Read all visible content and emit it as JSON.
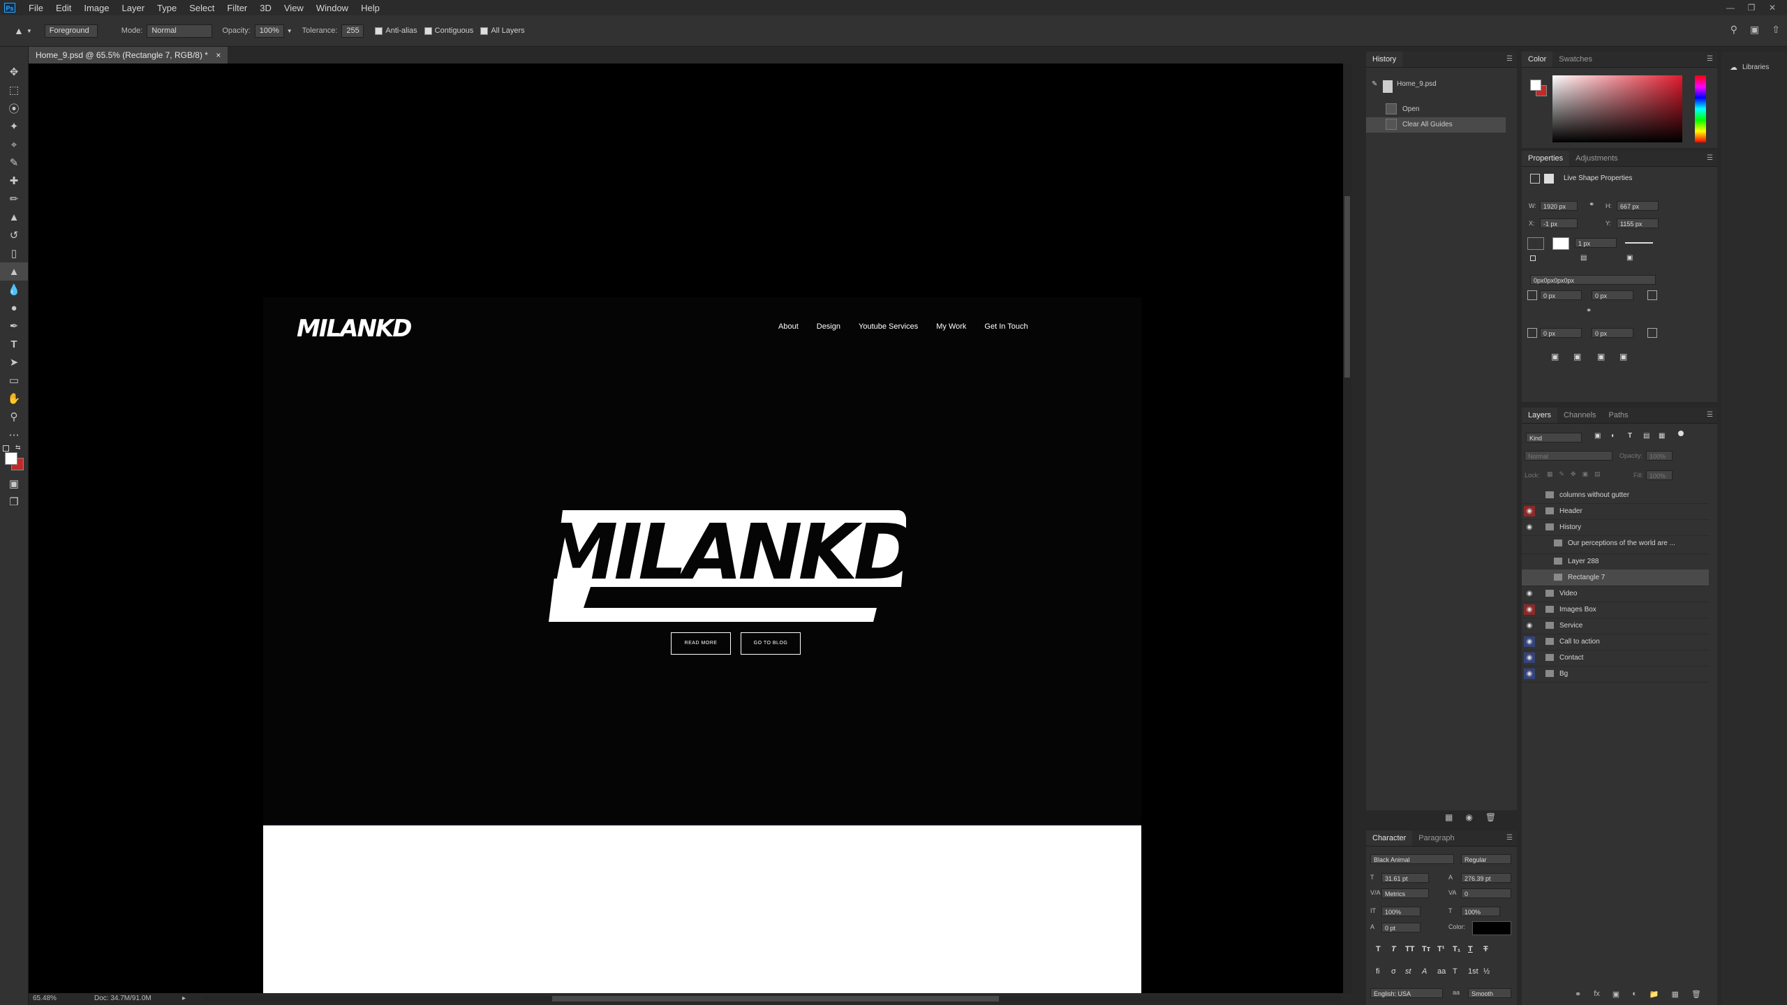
{
  "menu": {
    "items": [
      "File",
      "Edit",
      "Image",
      "Layer",
      "Type",
      "Select",
      "Filter",
      "3D",
      "View",
      "Window",
      "Help"
    ],
    "app_logo": "Ps"
  },
  "options": {
    "fill_source": "Foreground",
    "mode_label": "Mode:",
    "mode_value": "Normal",
    "opacity_label": "Opacity:",
    "opacity_value": "100%",
    "tolerance_label": "Tolerance:",
    "tolerance_value": "255",
    "anti_alias": "Anti-alias",
    "contiguous": "Contiguous",
    "all_layers": "All Layers"
  },
  "document": {
    "tab_title": "Home_9.psd @ 65.5% (Rectangle 7, RGB/8) *",
    "close": "×",
    "zoom": "65.48%",
    "doc_info": "Doc: 34.7M/91.0M"
  },
  "artboard": {
    "logo_small": "MILANKD",
    "nav": [
      "About",
      "Design",
      "Youtube Services",
      "My Work",
      "Get In Touch"
    ],
    "hero_logo": "MILANKD",
    "btn_read_more": "READ MORE",
    "btn_go_blog": "GO TO BLOG"
  },
  "history": {
    "tab": "History",
    "snapshot": "Home_9.psd",
    "steps": [
      "Open",
      "Clear All Guides"
    ]
  },
  "color_panel": {
    "tabs": [
      "Color",
      "Swatches"
    ]
  },
  "properties": {
    "tabs": [
      "Properties",
      "Adjustments"
    ],
    "heading": "Live Shape Properties",
    "w_label": "W:",
    "w": "1920 px",
    "h_label": "H:",
    "h": "667 px",
    "x_label": "X:",
    "x": "-1 px",
    "y_label": "Y:",
    "y": "1155 px",
    "stroke_width": "1 px",
    "corner_radii": "0px0px0px0px",
    "r1": "0 px",
    "r2": "0 px",
    "r3": "0 px",
    "r4": "0 px"
  },
  "layers": {
    "tabs": [
      "Layers",
      "Channels",
      "Paths"
    ],
    "filter_kind": "Kind",
    "blend": "Normal",
    "opacity_label": "Opacity:",
    "opacity": "100%",
    "lock_label": "Lock:",
    "fill_label": "Fill:",
    "fill": "100%",
    "rows": [
      {
        "name": "columns without gutter",
        "visible": false,
        "eye_color": ""
      },
      {
        "name": "Header",
        "visible": true,
        "eye_color": "#8b2a2a"
      },
      {
        "name": "History",
        "visible": true,
        "eye_color": ""
      },
      {
        "name": "Our perceptions of the world are ...",
        "visible": false,
        "eye_color": ""
      },
      {
        "name": "Layer 288",
        "visible": false,
        "eye_color": ""
      },
      {
        "name": "Rectangle 7",
        "visible": false,
        "eye_color": ""
      },
      {
        "name": "Video",
        "visible": true,
        "eye_color": ""
      },
      {
        "name": "Images Box",
        "visible": true,
        "eye_color": "#8b2a2a"
      },
      {
        "name": "Service",
        "visible": true,
        "eye_color": ""
      },
      {
        "name": "Call to action",
        "visible": true,
        "eye_color": "#34447a"
      },
      {
        "name": "Contact",
        "visible": true,
        "eye_color": "#34447a"
      },
      {
        "name": "Bg",
        "visible": true,
        "eye_color": "#34447a"
      }
    ]
  },
  "character": {
    "tabs": [
      "Character",
      "Paragraph"
    ],
    "font_family": "Black Animal",
    "font_style": "Regular",
    "size": "31.61 pt",
    "leading": "276.39 pt",
    "kerning": "Metrics",
    "tracking": "0",
    "vscale": "100%",
    "hscale": "100%",
    "baseline": "0 pt",
    "color_label": "Color:",
    "language": "English: USA",
    "antialias": "Smooth",
    "aa_label": "aa"
  },
  "libraries": {
    "label": "Libraries"
  },
  "colors": {
    "accent_red": "#8b2a2a",
    "accent_blue": "#34447a",
    "selected_row": "#4a4a4a"
  }
}
